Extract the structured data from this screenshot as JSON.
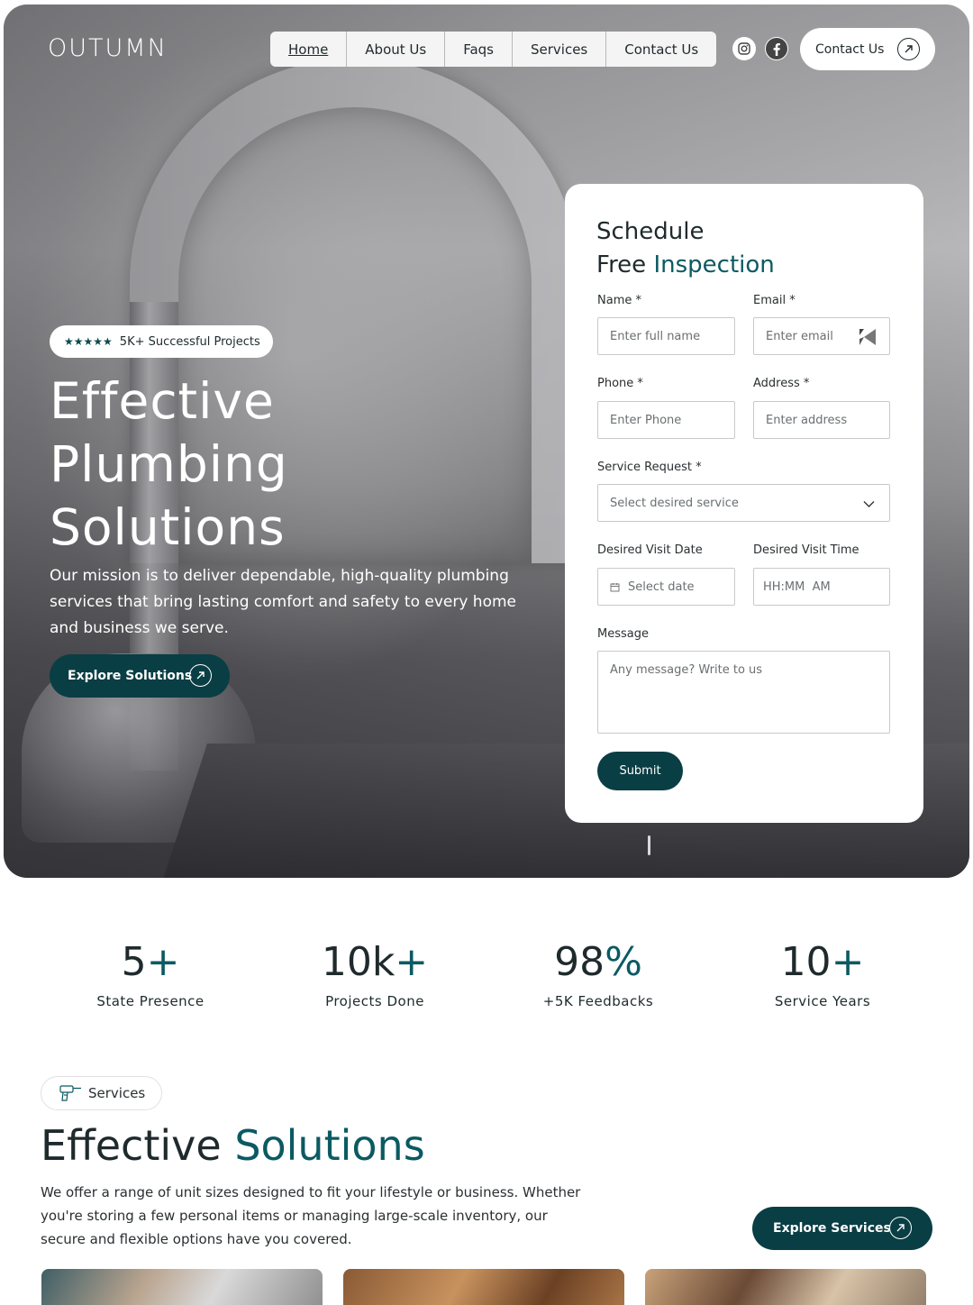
{
  "brand": {
    "logo": "OUTUMN"
  },
  "nav": {
    "items": [
      {
        "label": "Home",
        "active": true
      },
      {
        "label": "About Us",
        "active": false
      },
      {
        "label": "Faqs",
        "active": false
      },
      {
        "label": "Services",
        "active": false
      },
      {
        "label": "Contact Us",
        "active": false
      }
    ],
    "social": [
      "instagram-icon",
      "facebook-icon"
    ],
    "contact_button": "Contact Us"
  },
  "hero": {
    "badge_stars": "★★★★★",
    "badge_text": "5K+ Successful Projects",
    "title_line1": "Effective",
    "title_line2": "Plumbing",
    "title_line3": "Solutions",
    "subtitle": "Our mission is to deliver dependable, high-quality plumbing services that bring lasting comfort and safety to every home and business we serve.",
    "cta": "Explore Solutions"
  },
  "form": {
    "title_line1": "Schedule",
    "title_line2_plain": "Free ",
    "title_line2_accent": "Inspection",
    "name_label": "Name *",
    "name_placeholder": "Enter full name",
    "email_label": "Email *",
    "email_placeholder": "Enter email",
    "phone_label": "Phone *",
    "phone_placeholder": "Enter Phone",
    "address_label": "Address *",
    "address_placeholder": "Enter address",
    "service_label": "Service Request *",
    "service_placeholder": "Select desired service",
    "date_label": "Desired Visit Date",
    "date_placeholder": "Select date",
    "time_label": "Desired Visit Time",
    "time_placeholder": "HH:MM  AM",
    "message_label": "Message",
    "message_placeholder": "Any message? Write to us",
    "submit": "Submit"
  },
  "stats": [
    {
      "number": "5",
      "suffix": "+",
      "caption": "State Presence"
    },
    {
      "number": "10k",
      "suffix": "+",
      "caption": "Projects Done"
    },
    {
      "number": "98",
      "suffix": "%",
      "caption": "+5K Feedbacks"
    },
    {
      "number": "10",
      "suffix": "+",
      "caption": "Service Years"
    }
  ],
  "services": {
    "pill": "Services",
    "title_plain": "Effective ",
    "title_accent": "Solutions",
    "description": "We offer a range of unit sizes designed to fit your lifestyle or business. Whether you're storing a few personal items or managing large-scale inventory, our secure and flexible options have you covered.",
    "cta": "Explore Services"
  },
  "colors": {
    "accent": "#0b5a62",
    "button_dark": "#093e44"
  }
}
